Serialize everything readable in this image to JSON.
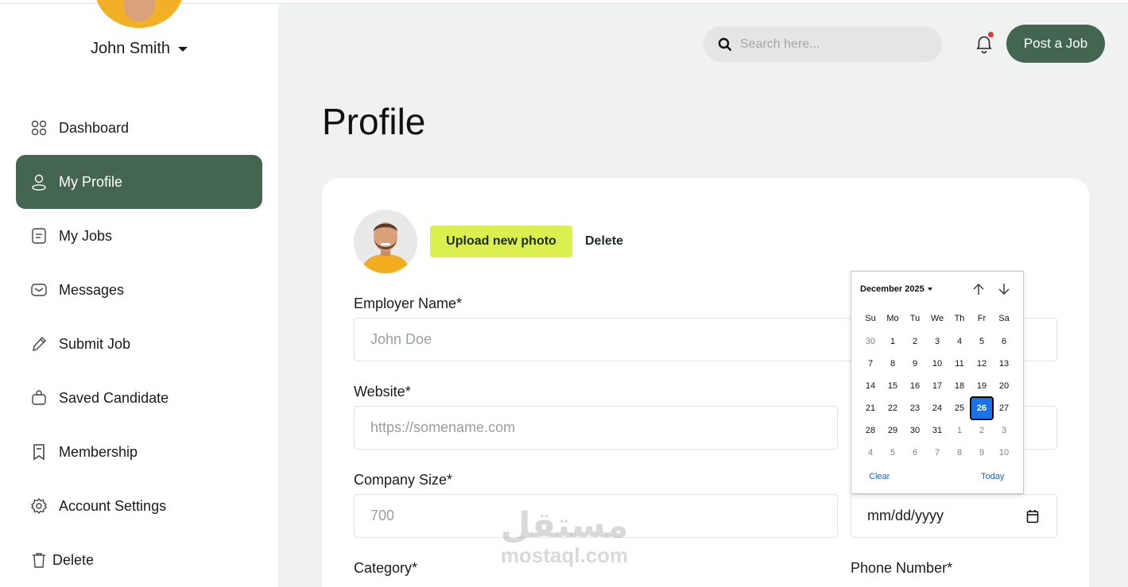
{
  "user": {
    "name": "John Smith"
  },
  "sidebar": {
    "items": [
      {
        "label": "Dashboard",
        "icon": "dashboard-icon"
      },
      {
        "label": "My Profile",
        "icon": "user-icon",
        "active": true
      },
      {
        "label": "My Jobs",
        "icon": "document-icon"
      },
      {
        "label": "Messages",
        "icon": "mail-icon"
      },
      {
        "label": "Submit Job",
        "icon": "pencil-icon"
      },
      {
        "label": "Saved Candidate",
        "icon": "bag-icon"
      },
      {
        "label": "Membership",
        "icon": "bookmark-icon"
      },
      {
        "label": "Account Settings",
        "icon": "gear-icon"
      },
      {
        "label": "Delete",
        "icon": "trash-icon"
      }
    ]
  },
  "header": {
    "search_placeholder": "Search here...",
    "post_job_label": "Post a Job"
  },
  "page": {
    "title": "Profile"
  },
  "profile": {
    "upload_label": "Upload new photo",
    "delete_label": "Delete",
    "fields": {
      "employer_name": {
        "label": "Employer Name*",
        "placeholder": "John Doe"
      },
      "website": {
        "label": "Website*",
        "placeholder": "https://somename.com"
      },
      "company_size": {
        "label": "Company Size*",
        "placeholder": "700"
      },
      "date": {
        "placeholder": "mm/dd/yyyy"
      },
      "category": {
        "label": "Category*"
      },
      "phone": {
        "label": "Phone Number*"
      }
    }
  },
  "datepicker": {
    "month_label": "December 2025",
    "weekdays": [
      "Su",
      "Mo",
      "Tu",
      "We",
      "Th",
      "Fr",
      "Sa"
    ],
    "days": [
      [
        "30",
        "1",
        "2",
        "3",
        "4",
        "5",
        "6"
      ],
      [
        "7",
        "8",
        "9",
        "10",
        "11",
        "12",
        "13"
      ],
      [
        "14",
        "15",
        "16",
        "17",
        "18",
        "19",
        "20"
      ],
      [
        "21",
        "22",
        "23",
        "24",
        "25",
        "26",
        "27"
      ],
      [
        "28",
        "29",
        "30",
        "31",
        "1",
        "2",
        "3"
      ],
      [
        "4",
        "5",
        "6",
        "7",
        "8",
        "9",
        "10"
      ]
    ],
    "selected": "26",
    "clear_label": "Clear",
    "today_label": "Today"
  },
  "watermark": {
    "arabic": "مستقل",
    "latin": "mostaql.com"
  },
  "colors": {
    "primary": "#446650",
    "accent": "#dbef4e",
    "selected_day": "#1a73e8",
    "notification": "#e53935"
  }
}
